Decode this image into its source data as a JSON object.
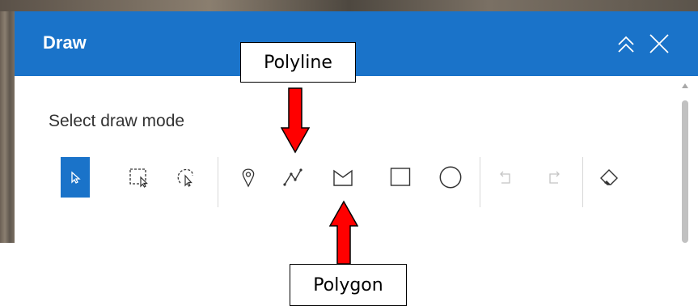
{
  "panel": {
    "title": "Draw",
    "collapse_icon": "double-chevron-up-icon",
    "close_icon": "close-icon"
  },
  "draw_mode": {
    "label": "Select draw mode",
    "tools": [
      {
        "name": "select",
        "icon": "cursor-icon",
        "active": true
      },
      {
        "name": "rectangle-select",
        "icon": "rectangle-select-icon",
        "active": false
      },
      {
        "name": "lasso-select",
        "icon": "lasso-select-icon",
        "active": false
      },
      {
        "name": "point",
        "icon": "map-pin-icon",
        "active": false
      },
      {
        "name": "polyline",
        "icon": "polyline-icon",
        "active": false
      },
      {
        "name": "polygon",
        "icon": "polygon-icon",
        "active": false
      },
      {
        "name": "rectangle",
        "icon": "rectangle-icon",
        "active": false
      },
      {
        "name": "circle",
        "icon": "circle-icon",
        "active": false
      },
      {
        "name": "undo",
        "icon": "undo-icon",
        "active": false,
        "disabled": true
      },
      {
        "name": "redo",
        "icon": "redo-icon",
        "active": false,
        "disabled": true
      },
      {
        "name": "erase",
        "icon": "eraser-icon",
        "active": false
      }
    ]
  },
  "annotations": {
    "polyline_label": "Polyline",
    "polygon_label": "Polygon",
    "arrow_color": "#ff0000"
  },
  "colors": {
    "header": "#1a73c9",
    "active_tool": "#1a73c9"
  }
}
